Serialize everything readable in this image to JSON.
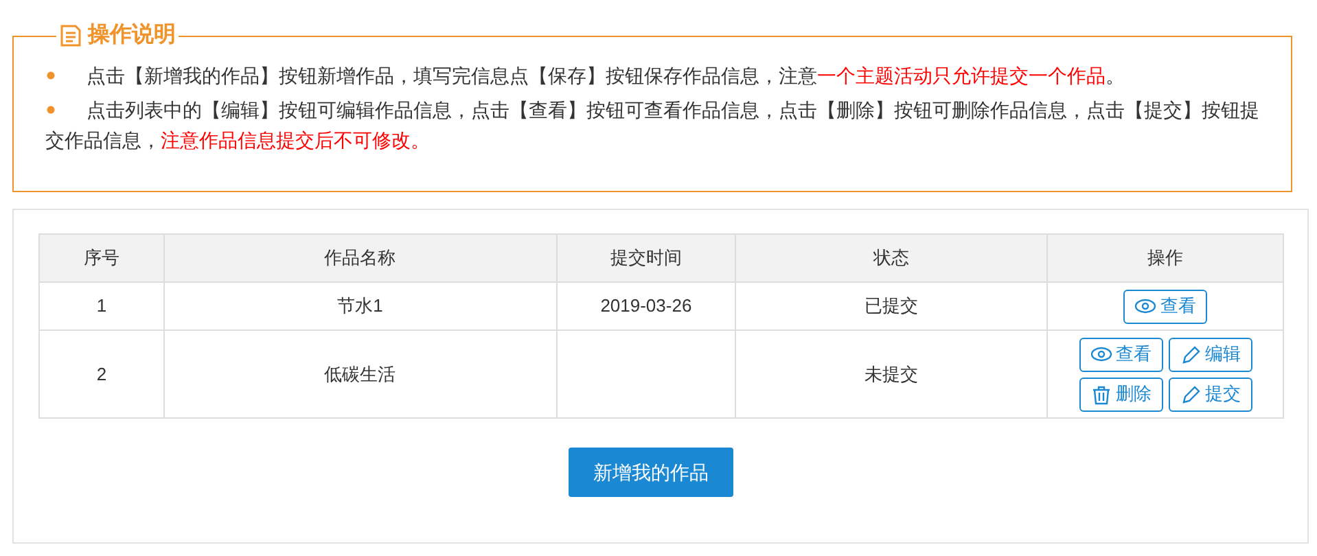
{
  "instructions": {
    "title": "操作说明",
    "items": [
      [
        {
          "text": "点击【新增我的作品】按钮新增作品，填写完信息点【保存】按钮保存作品信息，注意",
          "emphasis": false
        },
        {
          "text": "一个主题活动只允许提交一个作品",
          "emphasis": true
        },
        {
          "text": "。",
          "emphasis": false
        }
      ],
      [
        {
          "text": "点击列表中的【编辑】按钮可编辑作品信息，点击【查看】按钮可查看作品信息，点击【删除】按钮可删除作品信息，点击【提交】按钮提交作品信息，",
          "emphasis": false
        },
        {
          "text": "注意作品信息提交后不可修改。",
          "emphasis": true
        }
      ]
    ]
  },
  "table": {
    "columns": [
      "序号",
      "作品名称",
      "提交时间",
      "状态",
      "操作"
    ],
    "rows": [
      {
        "number": "1",
        "name": "节水1",
        "submitted_at": "2019-03-26",
        "status": "已提交",
        "actions": [
          {
            "kind": "view",
            "label": "查看"
          }
        ]
      },
      {
        "number": "2",
        "name": "低碳生活",
        "status": "未提交",
        "actions": [
          {
            "kind": "view",
            "label": "查看"
          },
          {
            "kind": "edit",
            "label": "编辑"
          },
          {
            "kind": "delete",
            "label": "删除"
          },
          {
            "kind": "submit",
            "label": "提交"
          }
        ]
      }
    ]
  },
  "add_button": "新增我的作品"
}
